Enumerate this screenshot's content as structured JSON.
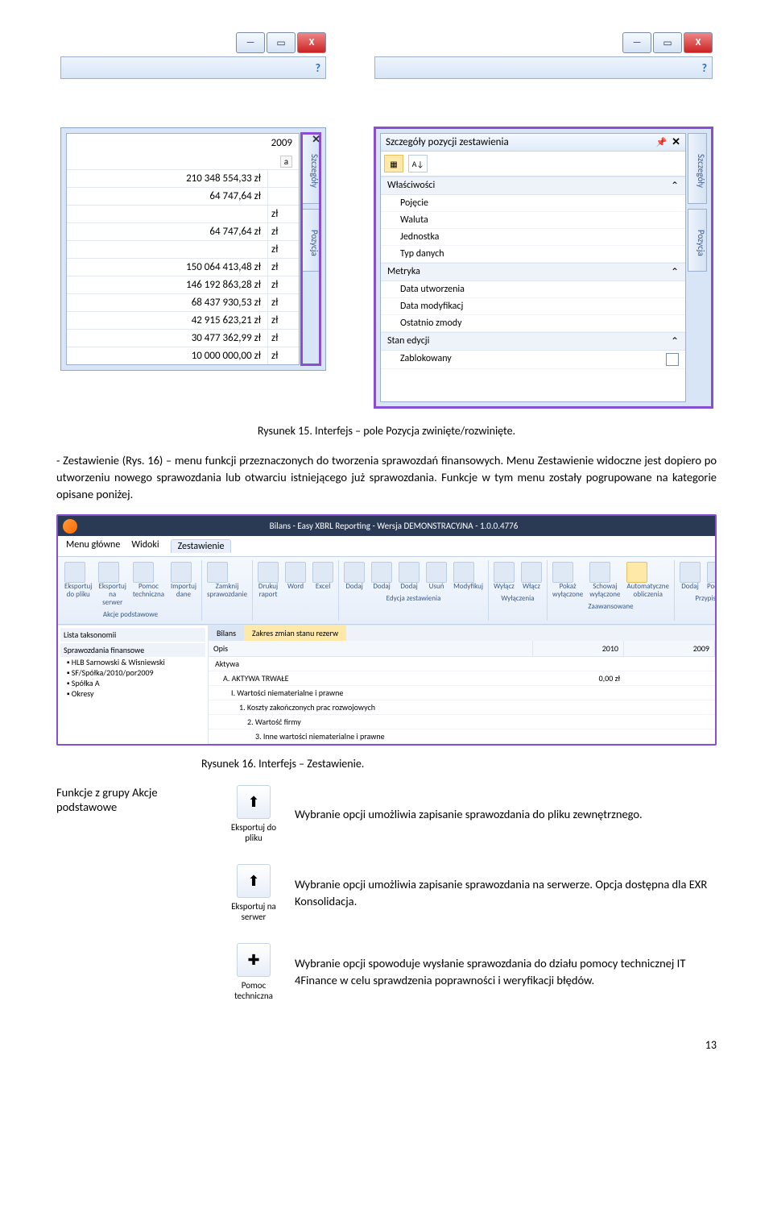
{
  "leftPanel": {
    "header": "2009",
    "badge": "a",
    "rows": [
      {
        "val": "210 348 554,33 zł",
        "unit": ""
      },
      {
        "val": "64 747,64 zł",
        "unit": ""
      },
      {
        "val": "",
        "unit": "zł"
      },
      {
        "val": "64 747,64 zł",
        "unit": "zł"
      },
      {
        "val": "",
        "unit": "zł"
      },
      {
        "val": "150 064 413,48 zł",
        "unit": "zł"
      },
      {
        "val": "146 192 863,28 zł",
        "unit": "zł"
      },
      {
        "val": "68 437 930,53 zł",
        "unit": "zł"
      },
      {
        "val": "42 915 623,21 zł",
        "unit": "zł"
      },
      {
        "val": "30 477 362,99 zł",
        "unit": "zł"
      },
      {
        "val": "10 000 000,00 zł",
        "unit": "zł"
      }
    ],
    "sideTabs": [
      "Szczegóły",
      "Pozycja"
    ]
  },
  "rightPanel": {
    "title": "Szczegóły pozycji zestawienia",
    "groups": [
      {
        "name": "Właściwości",
        "items": [
          "Pojęcie",
          "Waluta",
          "Jednostka",
          "Typ danych"
        ]
      },
      {
        "name": "Metryka",
        "items": [
          "Data utworzenia",
          "Data modyfikacj",
          "Ostatnio zmody"
        ]
      },
      {
        "name": "Stan edycji",
        "items": [
          "Zablokowany"
        ]
      }
    ],
    "sideTabs": [
      "Szczegóły",
      "Pozycja"
    ]
  },
  "caption1": "Rysunek 15. Interfejs – pole Pozycja zwinięte/rozwinięte.",
  "para1": "- Zestawienie (Rys. 16) – menu funkcji przeznaczonych do tworzenia sprawozdań finansowych. Menu Zestawienie widoczne jest dopiero po utworzeniu nowego sprawozdania lub otwarciu istniejącego już sprawozdania. Funkcje w tym menu zostały pogrupowane na kategorie opisane poniżej.",
  "ribbon": {
    "title": "Bilans - Easy XBRL Reporting - Wersja DEMONSTRACYJNA - 1.0.0.4776",
    "tabs": [
      "Menu główne",
      "Widoki",
      "Zestawienie"
    ],
    "groups": [
      {
        "name": "Akcje podstawowe",
        "btns": [
          "Eksportuj do pliku",
          "Eksportuj na serwer",
          "Pomoc techniczna",
          "Importuj dane"
        ]
      },
      {
        "name": " ",
        "btns": [
          "Zamknij sprawozdanie"
        ]
      },
      {
        "name": " ",
        "btns": [
          "Drukuj raport",
          "Word",
          "Excel"
        ]
      },
      {
        "name": "Edycja zestawienia",
        "btns": [
          "Dodaj",
          "Dodaj",
          "Dodaj",
          "Usuń",
          "Modyfikuj"
        ]
      },
      {
        "name": "Wyłączenia",
        "btns": [
          "Wyłącz",
          "Włącz"
        ]
      },
      {
        "name": "Zaawansowane",
        "btns": [
          "Pokaż wyłączone",
          "Schowaj wyłączone",
          "Automatyczne obliczenia"
        ]
      },
      {
        "name": "Przypis",
        "btns": [
          "Dodaj",
          "Podczep"
        ]
      }
    ],
    "side": {
      "title": "Lista taksonomii",
      "panel": "Sprawozdania finansowe",
      "items": [
        "HLB Sarnowski & Wisniewski",
        "SF/Spółka/2010/por2009",
        "Spółka A",
        "Okresy"
      ]
    },
    "main": {
      "tabs": [
        "Bilans",
        "Zakres zmian stanu rezerw"
      ],
      "cols": [
        "Opis",
        "2010",
        "2009"
      ],
      "rows": [
        "Aktywa",
        "A. AKTYWA TRWAŁE",
        "I. Wartości niematerialne i prawne",
        "1. Koszty zakończonych prac rozwojowych",
        "2. Wartość firmy",
        "3. Inne wartości niematerialne i prawne"
      ],
      "val2010": "0,00 zł"
    }
  },
  "caption2": "Rysunek 16. Interfejs – Zestawienie.",
  "funcHeader": "Funkcje z grupy Akcje podstawowe",
  "funcs": [
    {
      "icon": "⬆",
      "label": "Eksportuj do pliku",
      "desc": "Wybranie opcji umożliwia zapisanie sprawozdania do pliku zewnętrznego."
    },
    {
      "icon": "⬆",
      "label": "Eksportuj na serwer",
      "desc": "Wybranie opcji umożliwia zapisanie sprawozdania na serwerze. Opcja dostępna dla EXR Konsolidacja."
    },
    {
      "icon": "✚",
      "label": "Pomoc techniczna",
      "desc": "Wybranie opcji spowoduje wysłanie sprawozdania do działu pomocy technicznej  IT 4Finance w celu sprawdzenia poprawności i weryfikacji błędów."
    }
  ],
  "pagenum": "13"
}
